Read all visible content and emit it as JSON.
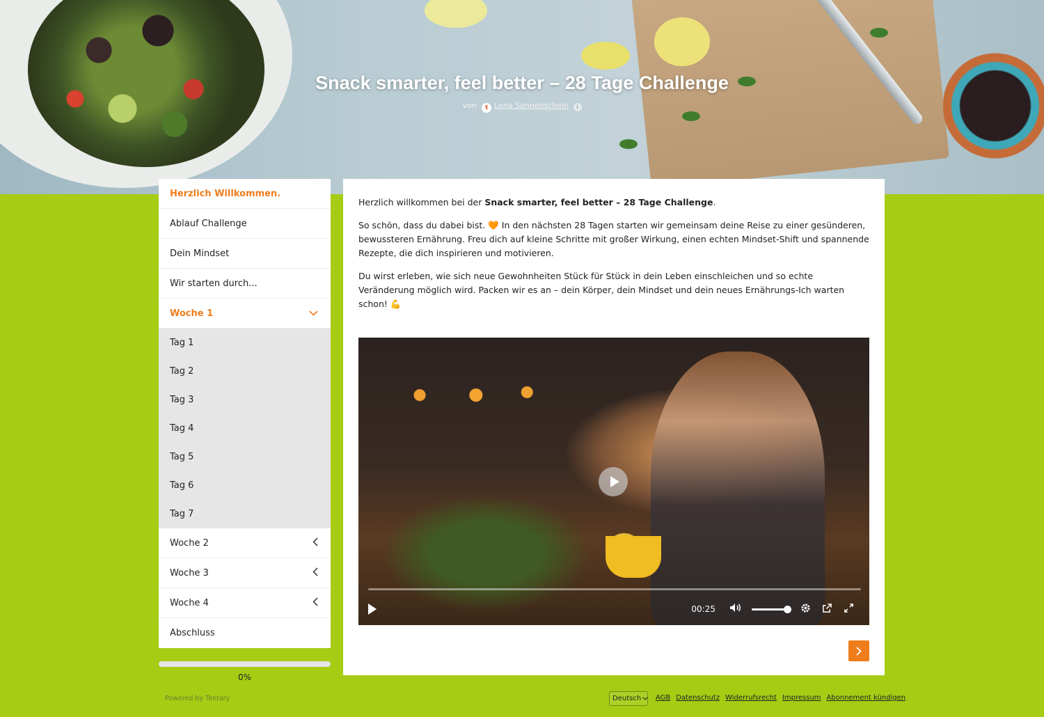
{
  "hero": {
    "title": "Snack smarter, feel better – 28 Tage Challenge",
    "by_label": "von",
    "author_initial": "t",
    "author": "Lena Sonnenschein",
    "info": "i"
  },
  "sidebar": {
    "items": [
      {
        "label": "Herzlich Willkommen.",
        "active": true
      },
      {
        "label": "Ablauf Challenge"
      },
      {
        "label": "Dein Mindset"
      },
      {
        "label": "Wir starten durch..."
      }
    ],
    "week1": {
      "label": "Woche 1",
      "expanded": true,
      "icon": "chevron-down-icon",
      "days": [
        "Tag 1",
        "Tag 2",
        "Tag 3",
        "Tag 4",
        "Tag 5",
        "Tag 6",
        "Tag 7"
      ]
    },
    "week2": {
      "label": "Woche 2",
      "icon": "chevron-left-icon"
    },
    "week3": {
      "label": "Woche 3",
      "icon": "chevron-left-icon"
    },
    "week4": {
      "label": "Woche 4",
      "icon": "chevron-left-icon"
    },
    "closing": {
      "label": "Abschluss"
    }
  },
  "progress": {
    "value": 0,
    "label": "0%"
  },
  "content": {
    "p1_pre": "Herzlich willkommen bei der ",
    "p1_bold": "Snack smarter, feel better – 28 Tage Challenge",
    "p1_post": ".",
    "p2": "So schön, dass du dabei bist. 🧡 In den nächsten 28 Tagen starten wir gemeinsam deine Reise zu einer gesünderen, bewussteren Ernährung. Freu dich auf kleine Schritte mit großer Wirkung, einen echten Mindset-Shift und spannende Rezepte, die dich inspirieren und motivieren.",
    "p3": "Du wirst erleben, wie sich neue Gewohnheiten Stück für Stück in dein Leben einschleichen und so echte Veränderung möglich wird. Packen wir es an – dein Körper, dein Mindset und dein neues Ernährungs-Ich warten schon! 💪"
  },
  "video": {
    "time": "00:25",
    "icons": [
      "play-icon",
      "volume-icon",
      "settings-icon",
      "external-link-icon",
      "fullscreen-icon"
    ]
  },
  "footer": {
    "powered": "Powered by Tentary",
    "language": "Deutsch",
    "links": [
      "AGB",
      "Datenschutz",
      "Widerrufsrecht",
      "Impressum",
      "Abonnement kündigen"
    ]
  },
  "colors": {
    "accent": "#ef7d1c",
    "background": "#a6cc14"
  }
}
